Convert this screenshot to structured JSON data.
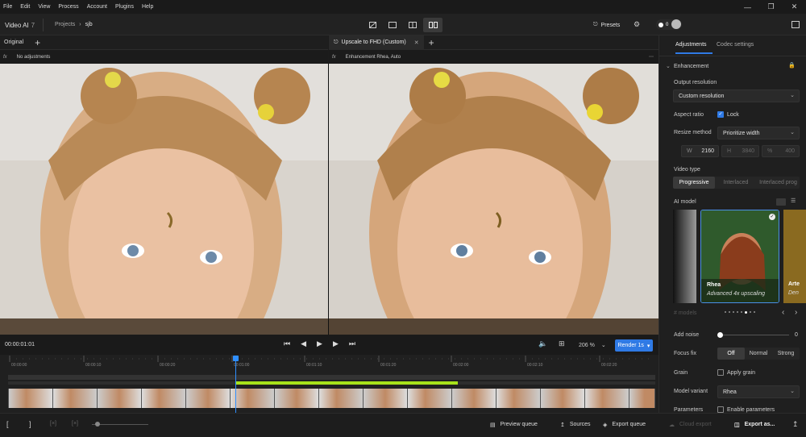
{
  "menu": [
    "File",
    "Edit",
    "View",
    "Process",
    "Account",
    "Plugins",
    "Help"
  ],
  "app": {
    "name": "Video AI",
    "version": "7"
  },
  "breadcrumb": {
    "root": "Projects",
    "current": "sjb"
  },
  "presets_label": "Presets",
  "toggle_value": "0",
  "left_pane": {
    "title": "Original",
    "sub": "No adjustments"
  },
  "right_pane": {
    "title": "Upscale to FHD (Custom)",
    "sub": "Enhancement  Rhea, Auto"
  },
  "sidebar": {
    "tabs": [
      "Adjustments",
      "Codec settings"
    ],
    "section": "Enhancement",
    "output_resolution_label": "Output resolution",
    "output_resolution_value": "Custom resolution",
    "aspect_label": "Aspect ratio",
    "aspect_lock": "Lock",
    "resize_label": "Resize method",
    "resize_value": "Prioritize width",
    "w_label": "W",
    "w_value": "2160",
    "h_label": "H",
    "h_value": "3840",
    "pct_label": "%",
    "pct_value": "400",
    "video_type_label": "Video type",
    "video_types": [
      "Progressive",
      "Interlaced",
      "Interlaced prog"
    ],
    "ai_model_label": "AI model",
    "models_count": "# models",
    "model_card": {
      "name": "Rhea",
      "desc": "Advanced 4x upscaling"
    },
    "model_card_next": {
      "name": "Arte",
      "desc": "Den"
    },
    "add_noise_label": "Add noise",
    "add_noise_value": "0",
    "focus_fix_label": "Focus fix",
    "focus_options": [
      "Off",
      "Normal",
      "Strong"
    ],
    "grain_label": "Grain",
    "grain_check": "Apply grain",
    "variant_label": "Model variant",
    "variant_value": "Rhea",
    "params_label": "Parameters",
    "params_check": "Enable parameters",
    "cloud_export": "Cloud export",
    "export_as": "Export as..."
  },
  "controls": {
    "timecode": "00:00:01:01",
    "zoom": "206 %",
    "render": "Render 1s"
  },
  "ruler": [
    "00:00:00",
    "00:00:10",
    "00:00:20",
    "00:01:00",
    "00:01:10",
    "00:01:20",
    "00:02:00",
    "00:02:10",
    "00:02:20"
  ],
  "bottom": {
    "preview_queue": "Preview queue",
    "sources": "Sources",
    "export_queue": "Export queue"
  },
  "colors": {
    "accent": "#2f7ae5",
    "track_green": "#a7e21a",
    "playhead": "#2f8fff"
  }
}
